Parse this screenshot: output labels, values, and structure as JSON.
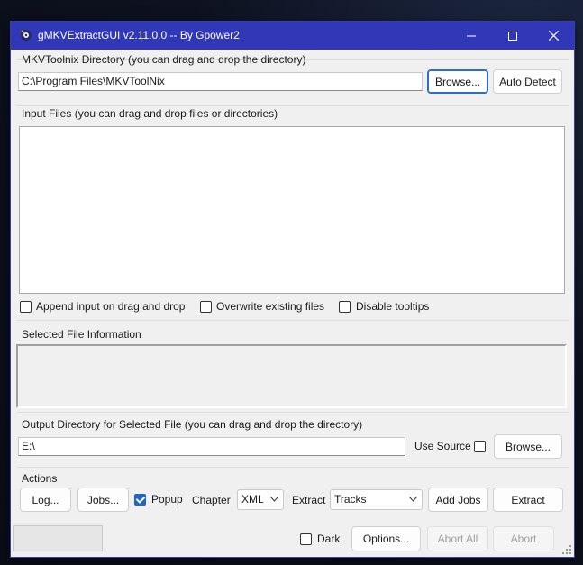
{
  "window": {
    "title": "gMKVExtractGUI v2.11.0.0 -- By Gpower2",
    "controls": [
      "minimize-icon",
      "maximize-icon",
      "close-icon"
    ]
  },
  "mkvtoolnix": {
    "label": "MKVToolnix Directory (you can drag and drop the directory)",
    "path": "C:\\Program Files\\MKVToolNix",
    "browse": "Browse...",
    "auto_detect": "Auto Detect"
  },
  "input": {
    "label": "Input Files (you can drag and drop files or directories)",
    "append": "Append input on drag and drop",
    "overwrite": "Overwrite existing files",
    "disable_tooltips": "Disable tooltips",
    "append_checked": false,
    "overwrite_checked": false,
    "disable_tooltips_checked": false
  },
  "selected": {
    "label": "Selected File Information"
  },
  "output": {
    "label": "Output Directory for Selected File (you can drag and drop the directory)",
    "path": "E:\\",
    "use_source": "Use Source",
    "use_source_checked": false,
    "browse": "Browse..."
  },
  "actions": {
    "label": "Actions",
    "log": "Log...",
    "jobs": "Jobs...",
    "popup": "Popup",
    "popup_checked": true,
    "chapter_label": "Chapter",
    "chapter_value": "XML",
    "extract_label": "Extract",
    "extract_value": "Tracks",
    "add_jobs": "Add Jobs",
    "extract": "Extract"
  },
  "bottom": {
    "dark": "Dark",
    "dark_checked": false,
    "options": "Options...",
    "abort_all": "Abort All",
    "abort": "Abort"
  },
  "colors": {
    "titlebar": "#3038b8",
    "accent": "#1f66c7"
  }
}
